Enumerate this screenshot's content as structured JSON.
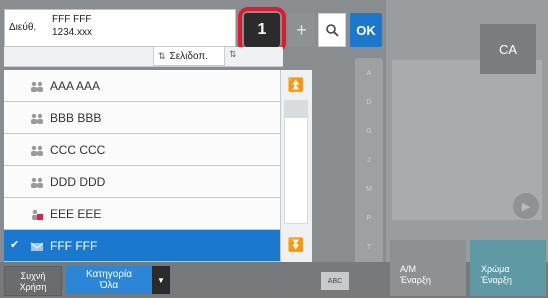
{
  "address": {
    "label": "Διεύθ.",
    "name": "FFF FFF",
    "email": "1234.xxx"
  },
  "toolbar": {
    "number": "1",
    "plus": "+",
    "ok": "OK"
  },
  "sort": {
    "label": "Σελιδοπ."
  },
  "list": [
    {
      "name": "AAA AAA",
      "icon": "group-icon",
      "selected": false
    },
    {
      "name": "BBB BBB",
      "icon": "group-icon",
      "selected": false
    },
    {
      "name": "CCC CCC",
      "icon": "group-icon",
      "selected": false
    },
    {
      "name": "DDD DDD",
      "icon": "group-icon",
      "selected": false
    },
    {
      "name": "EEE EEE",
      "icon": "fax-group-icon",
      "selected": false
    },
    {
      "name": "FFF FFF",
      "icon": "email-icon",
      "selected": true
    }
  ],
  "index_letters": [
    "A",
    "D",
    "G",
    "J",
    "M",
    "P",
    "T",
    "W"
  ],
  "bottom": {
    "frequent_line1": "Συχνή",
    "frequent_line2": "Χρήση",
    "category_line1": "Κατηγορία",
    "category_line2": "Όλα",
    "abc": "ABC"
  },
  "right": {
    "ca": "CA",
    "am_line1": "Α/Μ",
    "am_line2": "Έναρξη",
    "color_line1": "Χρώμα",
    "color_line2": "Έναρξη"
  },
  "colors": {
    "accent": "#1a78cf",
    "highlight": "#e2192e"
  }
}
